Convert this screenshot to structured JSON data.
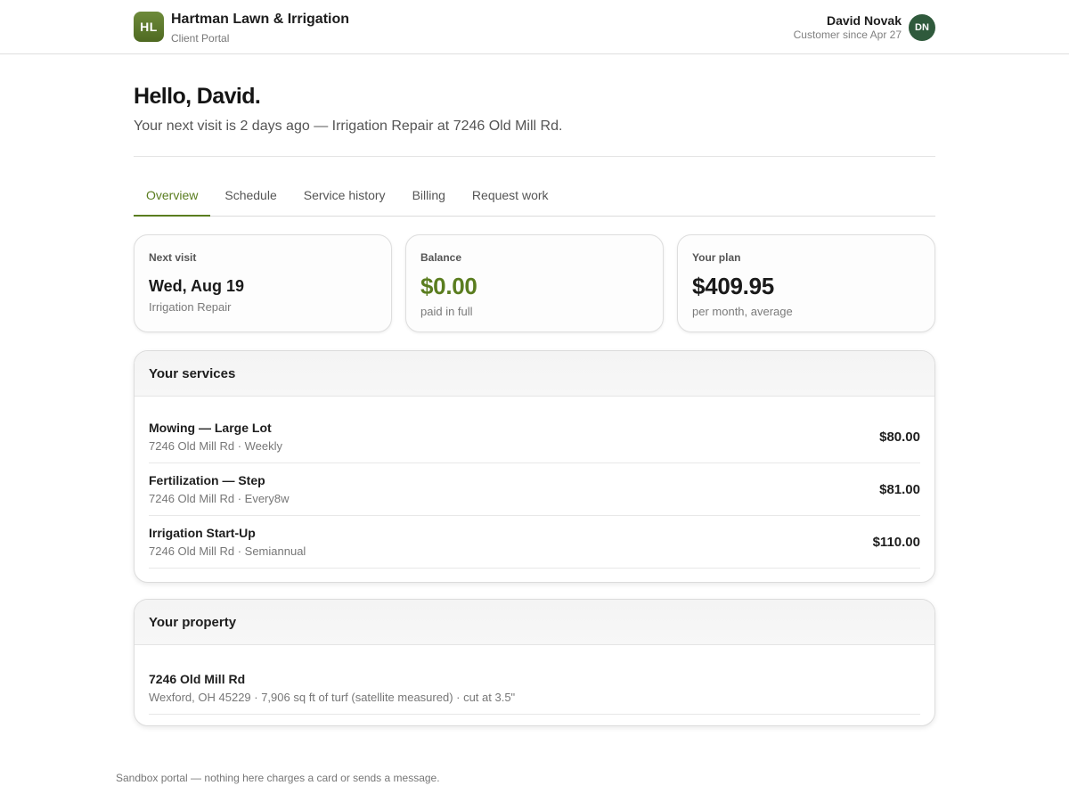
{
  "header": {
    "logo_initials": "HL",
    "brand_name": "Hartman Lawn & Irrigation",
    "brand_sub": "Client Portal",
    "user_name": "David Novak",
    "user_since": "Customer since Apr 27",
    "avatar_initials": "DN"
  },
  "greeting": {
    "title": "Hello, David.",
    "next_visit_line": "Your next visit is 2 days ago — Irrigation Repair at 7246 Old Mill Rd."
  },
  "tabs": [
    {
      "label": "Overview",
      "active": true
    },
    {
      "label": "Schedule",
      "active": false
    },
    {
      "label": "Service history",
      "active": false
    },
    {
      "label": "Billing",
      "active": false
    },
    {
      "label": "Request work",
      "active": false
    }
  ],
  "cards": {
    "next_visit": {
      "label": "Next visit",
      "value": "Wed, Aug 19",
      "sub": "Irrigation Repair"
    },
    "balance": {
      "label": "Balance",
      "value": "$0.00",
      "sub": "paid in full"
    },
    "plan": {
      "label": "Your plan",
      "value": "$409.95",
      "sub": "per month, average"
    }
  },
  "services": {
    "title": "Your services",
    "items": [
      {
        "name": "Mowing — Large Lot",
        "detail": "7246 Old Mill Rd · Weekly",
        "price": "$80.00"
      },
      {
        "name": "Fertilization — Step",
        "detail": "7246 Old Mill Rd · Every8w",
        "price": "$81.00"
      },
      {
        "name": "Irrigation Start-Up",
        "detail": "7246 Old Mill Rd · Semiannual",
        "price": "$110.00"
      }
    ]
  },
  "property": {
    "title": "Your property",
    "address": "7246 Old Mill Rd",
    "detail": "Wexford, OH 45229 · 7,906 sq ft of turf (satellite measured) · cut at 3.5\""
  },
  "footer": {
    "note": "Sandbox portal — nothing here charges a card or sends a message."
  },
  "colors": {
    "accent": "#5a7d1f",
    "logo": "#5f7c2e",
    "avatar": "#2f5a3c"
  }
}
